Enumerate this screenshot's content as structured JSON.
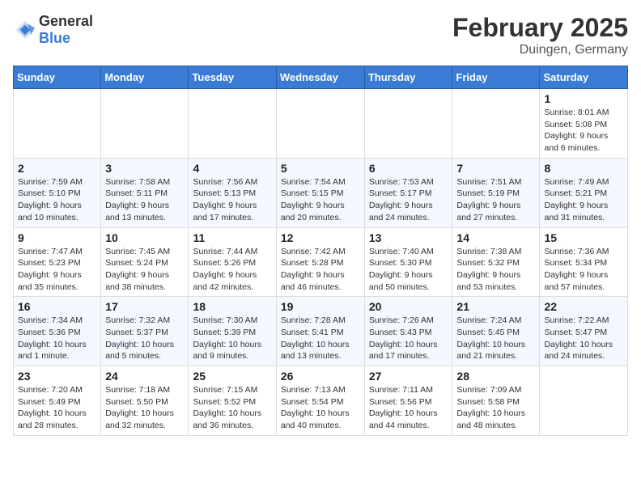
{
  "logo": {
    "text_general": "General",
    "text_blue": "Blue"
  },
  "header": {
    "month": "February 2025",
    "location": "Duingen, Germany"
  },
  "weekdays": [
    "Sunday",
    "Monday",
    "Tuesday",
    "Wednesday",
    "Thursday",
    "Friday",
    "Saturday"
  ],
  "weeks": [
    [
      {
        "day": "",
        "info": ""
      },
      {
        "day": "",
        "info": ""
      },
      {
        "day": "",
        "info": ""
      },
      {
        "day": "",
        "info": ""
      },
      {
        "day": "",
        "info": ""
      },
      {
        "day": "",
        "info": ""
      },
      {
        "day": "1",
        "info": "Sunrise: 8:01 AM\nSunset: 5:08 PM\nDaylight: 9 hours and 6 minutes."
      }
    ],
    [
      {
        "day": "2",
        "info": "Sunrise: 7:59 AM\nSunset: 5:10 PM\nDaylight: 9 hours and 10 minutes."
      },
      {
        "day": "3",
        "info": "Sunrise: 7:58 AM\nSunset: 5:11 PM\nDaylight: 9 hours and 13 minutes."
      },
      {
        "day": "4",
        "info": "Sunrise: 7:56 AM\nSunset: 5:13 PM\nDaylight: 9 hours and 17 minutes."
      },
      {
        "day": "5",
        "info": "Sunrise: 7:54 AM\nSunset: 5:15 PM\nDaylight: 9 hours and 20 minutes."
      },
      {
        "day": "6",
        "info": "Sunrise: 7:53 AM\nSunset: 5:17 PM\nDaylight: 9 hours and 24 minutes."
      },
      {
        "day": "7",
        "info": "Sunrise: 7:51 AM\nSunset: 5:19 PM\nDaylight: 9 hours and 27 minutes."
      },
      {
        "day": "8",
        "info": "Sunrise: 7:49 AM\nSunset: 5:21 PM\nDaylight: 9 hours and 31 minutes."
      }
    ],
    [
      {
        "day": "9",
        "info": "Sunrise: 7:47 AM\nSunset: 5:23 PM\nDaylight: 9 hours and 35 minutes."
      },
      {
        "day": "10",
        "info": "Sunrise: 7:45 AM\nSunset: 5:24 PM\nDaylight: 9 hours and 38 minutes."
      },
      {
        "day": "11",
        "info": "Sunrise: 7:44 AM\nSunset: 5:26 PM\nDaylight: 9 hours and 42 minutes."
      },
      {
        "day": "12",
        "info": "Sunrise: 7:42 AM\nSunset: 5:28 PM\nDaylight: 9 hours and 46 minutes."
      },
      {
        "day": "13",
        "info": "Sunrise: 7:40 AM\nSunset: 5:30 PM\nDaylight: 9 hours and 50 minutes."
      },
      {
        "day": "14",
        "info": "Sunrise: 7:38 AM\nSunset: 5:32 PM\nDaylight: 9 hours and 53 minutes."
      },
      {
        "day": "15",
        "info": "Sunrise: 7:36 AM\nSunset: 5:34 PM\nDaylight: 9 hours and 57 minutes."
      }
    ],
    [
      {
        "day": "16",
        "info": "Sunrise: 7:34 AM\nSunset: 5:36 PM\nDaylight: 10 hours and 1 minute."
      },
      {
        "day": "17",
        "info": "Sunrise: 7:32 AM\nSunset: 5:37 PM\nDaylight: 10 hours and 5 minutes."
      },
      {
        "day": "18",
        "info": "Sunrise: 7:30 AM\nSunset: 5:39 PM\nDaylight: 10 hours and 9 minutes."
      },
      {
        "day": "19",
        "info": "Sunrise: 7:28 AM\nSunset: 5:41 PM\nDaylight: 10 hours and 13 minutes."
      },
      {
        "day": "20",
        "info": "Sunrise: 7:26 AM\nSunset: 5:43 PM\nDaylight: 10 hours and 17 minutes."
      },
      {
        "day": "21",
        "info": "Sunrise: 7:24 AM\nSunset: 5:45 PM\nDaylight: 10 hours and 21 minutes."
      },
      {
        "day": "22",
        "info": "Sunrise: 7:22 AM\nSunset: 5:47 PM\nDaylight: 10 hours and 24 minutes."
      }
    ],
    [
      {
        "day": "23",
        "info": "Sunrise: 7:20 AM\nSunset: 5:49 PM\nDaylight: 10 hours and 28 minutes."
      },
      {
        "day": "24",
        "info": "Sunrise: 7:18 AM\nSunset: 5:50 PM\nDaylight: 10 hours and 32 minutes."
      },
      {
        "day": "25",
        "info": "Sunrise: 7:15 AM\nSunset: 5:52 PM\nDaylight: 10 hours and 36 minutes."
      },
      {
        "day": "26",
        "info": "Sunrise: 7:13 AM\nSunset: 5:54 PM\nDaylight: 10 hours and 40 minutes."
      },
      {
        "day": "27",
        "info": "Sunrise: 7:11 AM\nSunset: 5:56 PM\nDaylight: 10 hours and 44 minutes."
      },
      {
        "day": "28",
        "info": "Sunrise: 7:09 AM\nSunset: 5:58 PM\nDaylight: 10 hours and 48 minutes."
      },
      {
        "day": "",
        "info": ""
      }
    ]
  ]
}
